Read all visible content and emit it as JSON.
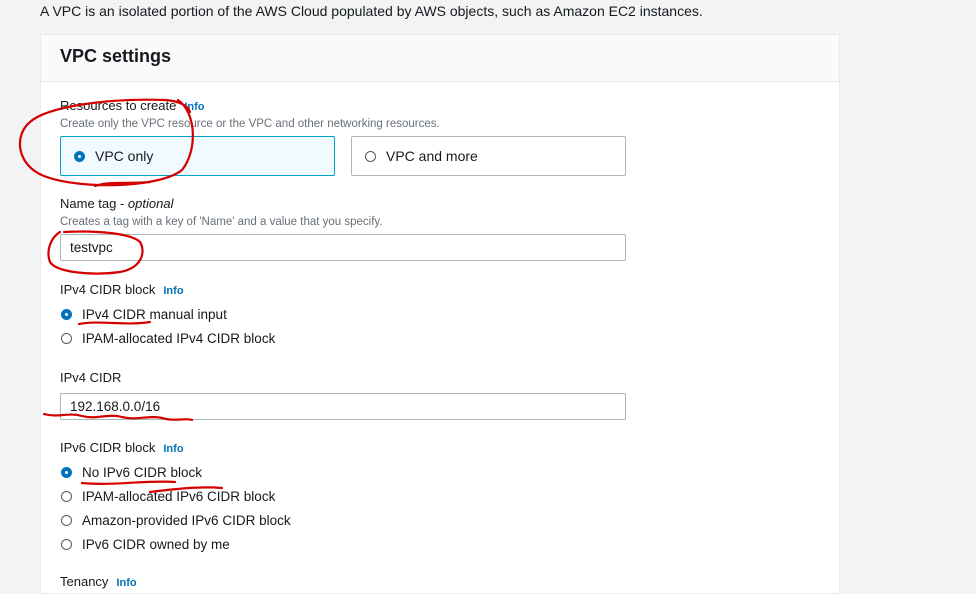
{
  "intro_text": "A VPC is an isolated portion of the AWS Cloud populated by AWS objects, such as Amazon EC2 instances.",
  "panel_title": "VPC settings",
  "resources": {
    "label": "Resources to create",
    "info": "Info",
    "description": "Create only the VPC resource or the VPC and other networking resources.",
    "options": [
      {
        "label": "VPC only",
        "selected": true
      },
      {
        "label": "VPC and more",
        "selected": false
      }
    ]
  },
  "name_tag": {
    "label": "Name tag - ",
    "optional": "optional",
    "description": "Creates a tag with a key of 'Name' and a value that you specify.",
    "value": "testvpc"
  },
  "ipv4_block": {
    "label": "IPv4 CIDR block",
    "info": "Info",
    "options": [
      {
        "label": "IPv4 CIDR manual input",
        "selected": true
      },
      {
        "label": "IPAM-allocated IPv4 CIDR block",
        "selected": false
      }
    ]
  },
  "ipv4_cidr": {
    "label": "IPv4 CIDR",
    "value": "192.168.0.0/16"
  },
  "ipv6_block": {
    "label": "IPv6 CIDR block",
    "info": "Info",
    "options": [
      {
        "label": "No IPv6 CIDR block",
        "selected": true
      },
      {
        "label": "IPAM-allocated IPv6 CIDR block",
        "selected": false
      },
      {
        "label": "Amazon-provided IPv6 CIDR block",
        "selected": false
      },
      {
        "label": "IPv6 CIDR owned by me",
        "selected": false
      }
    ]
  },
  "tenancy": {
    "label": "Tenancy",
    "info": "Info"
  },
  "colors": {
    "accent": "#0073bb",
    "selected_border": "#00a1c9",
    "annotation": "#d40000"
  }
}
